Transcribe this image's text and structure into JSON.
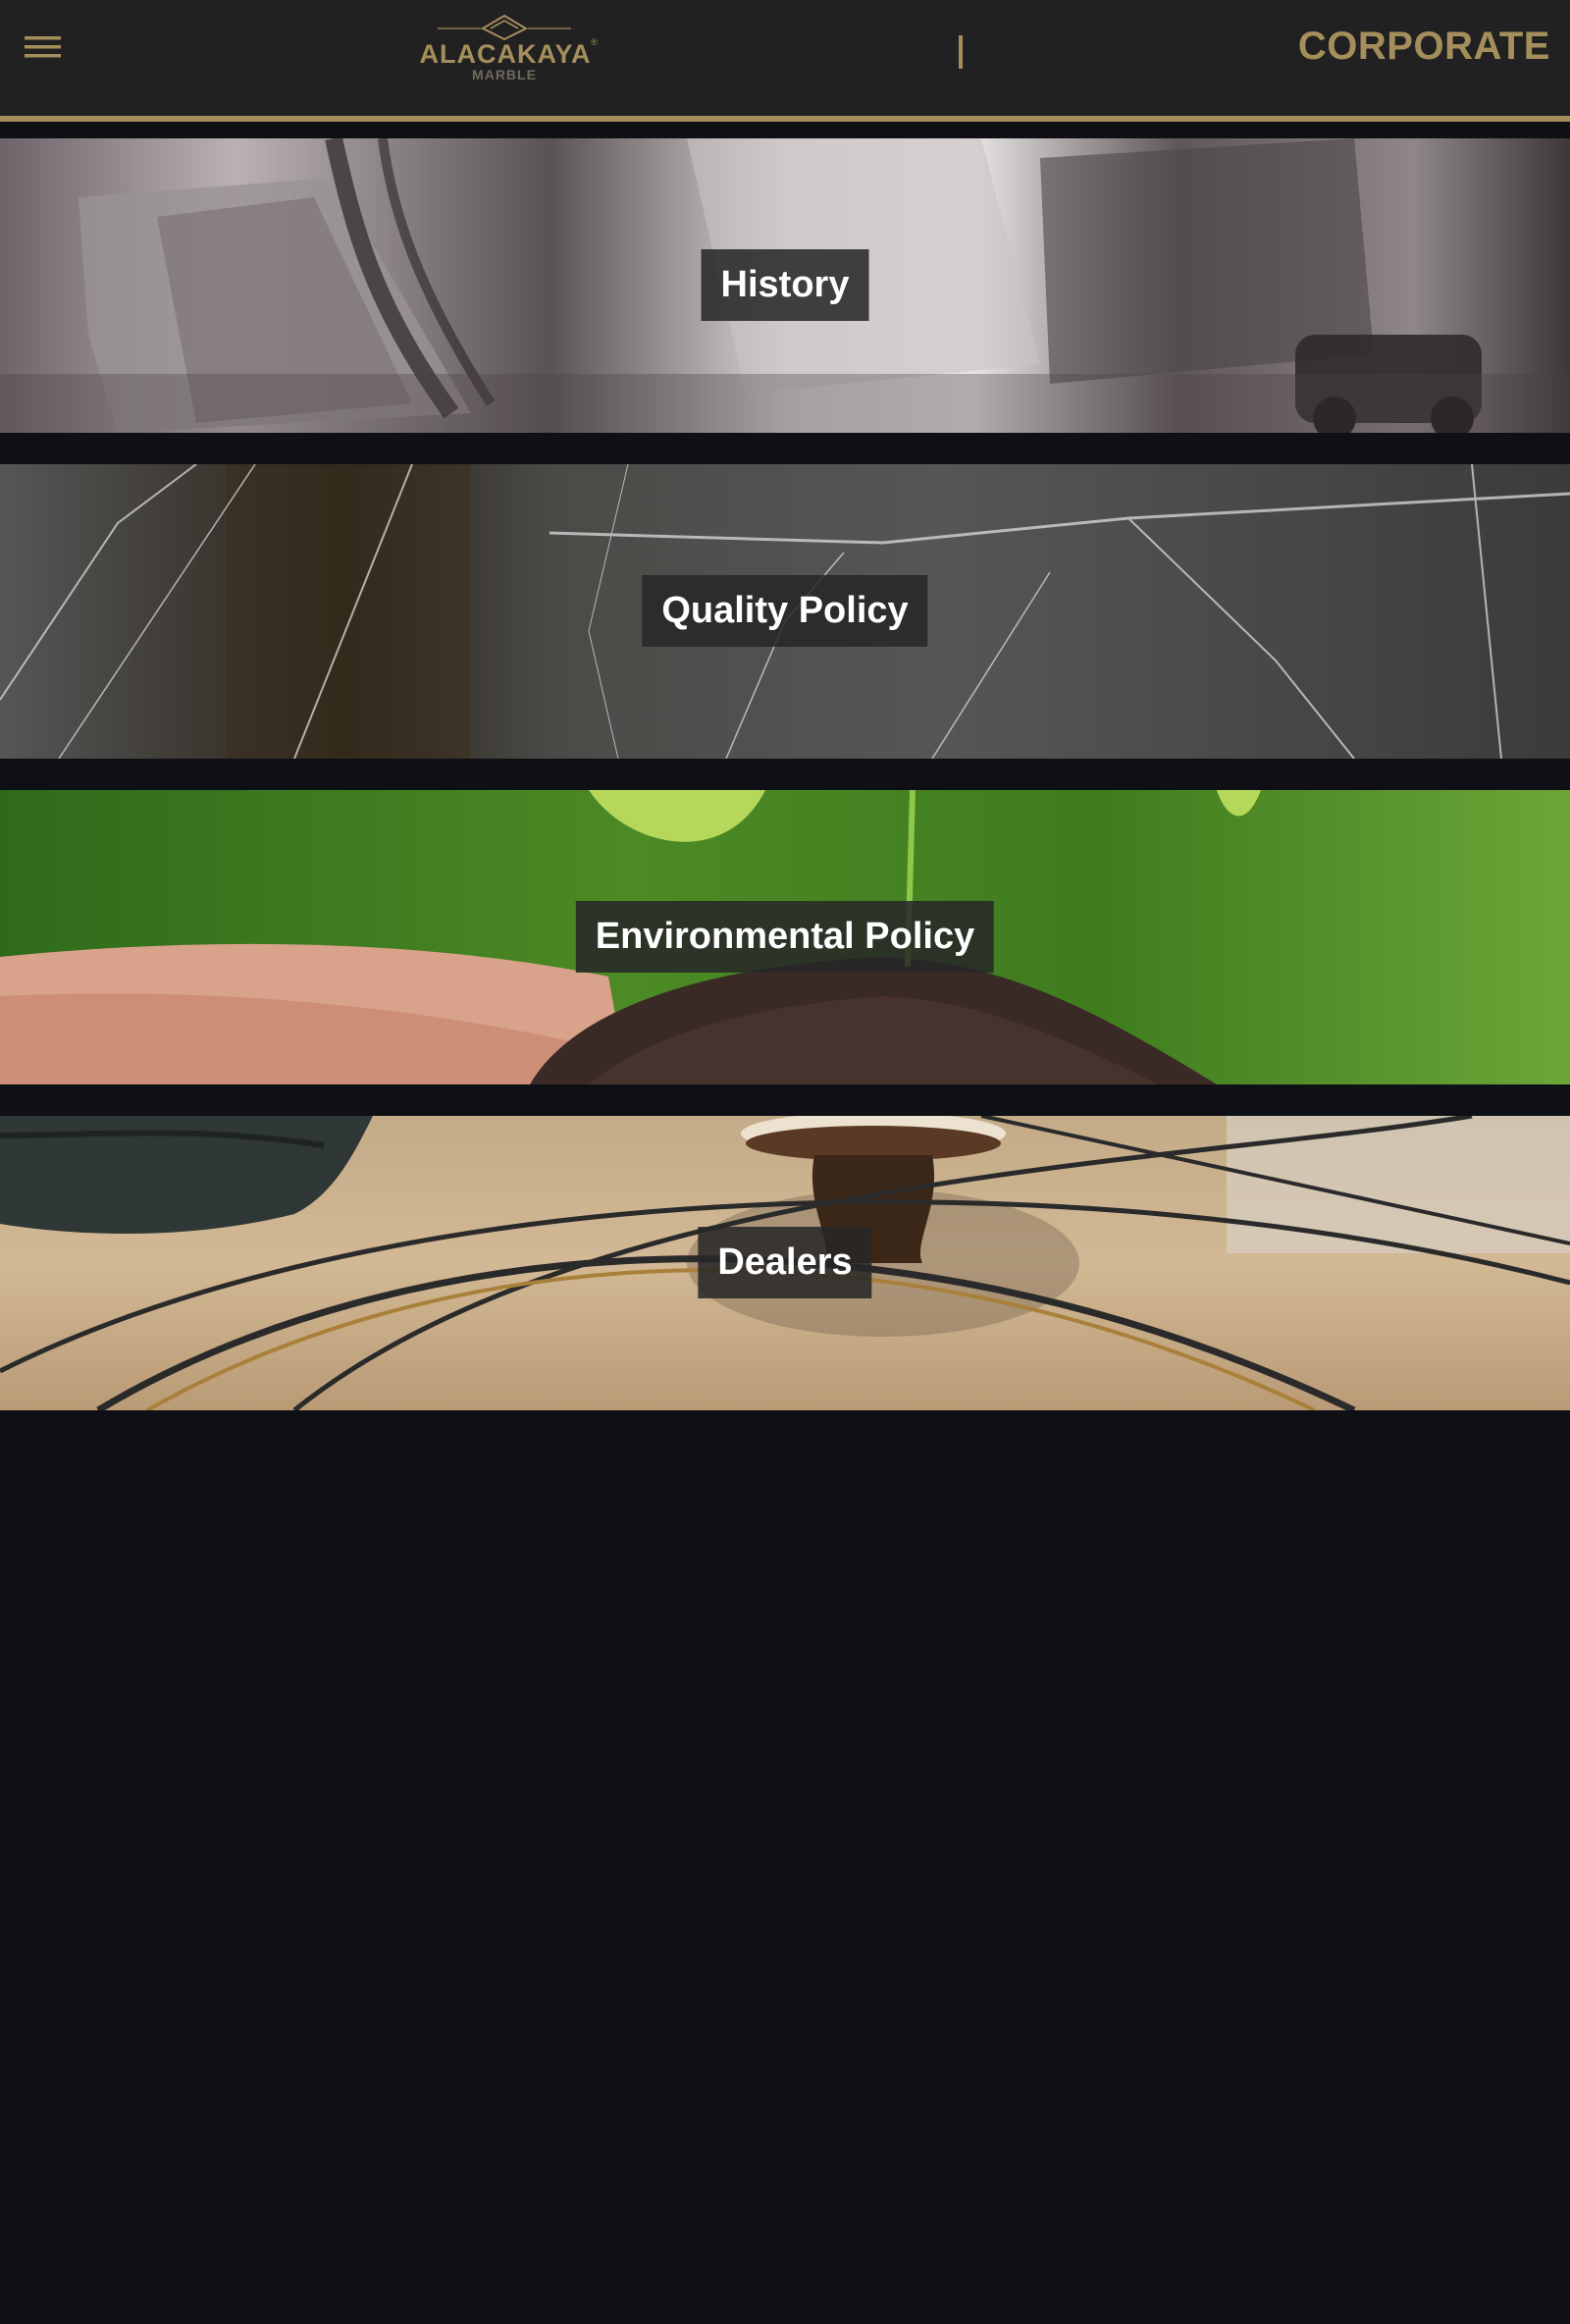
{
  "header": {
    "menu_icon": "hamburger-menu-icon",
    "logo": {
      "wordmark": "ALACAKAYA",
      "registered": "®",
      "subtitle": "MARBLE"
    },
    "page_title": "CORPORATE"
  },
  "banners": [
    {
      "label": "History",
      "image": "black-and-white marble quarry photograph"
    },
    {
      "label": "Quality Policy",
      "image": "black marble with white veins"
    },
    {
      "label": "Environmental Policy",
      "image": "hands holding soil with green sprout"
    },
    {
      "label": "Dealers",
      "image": "polished beige marble floor with round table"
    }
  ],
  "colors": {
    "header_bg": "#212121",
    "accent_gold": "#a48e5c",
    "page_bg": "#0f1016",
    "label_bg": "#262626",
    "label_text": "#ffffff"
  }
}
